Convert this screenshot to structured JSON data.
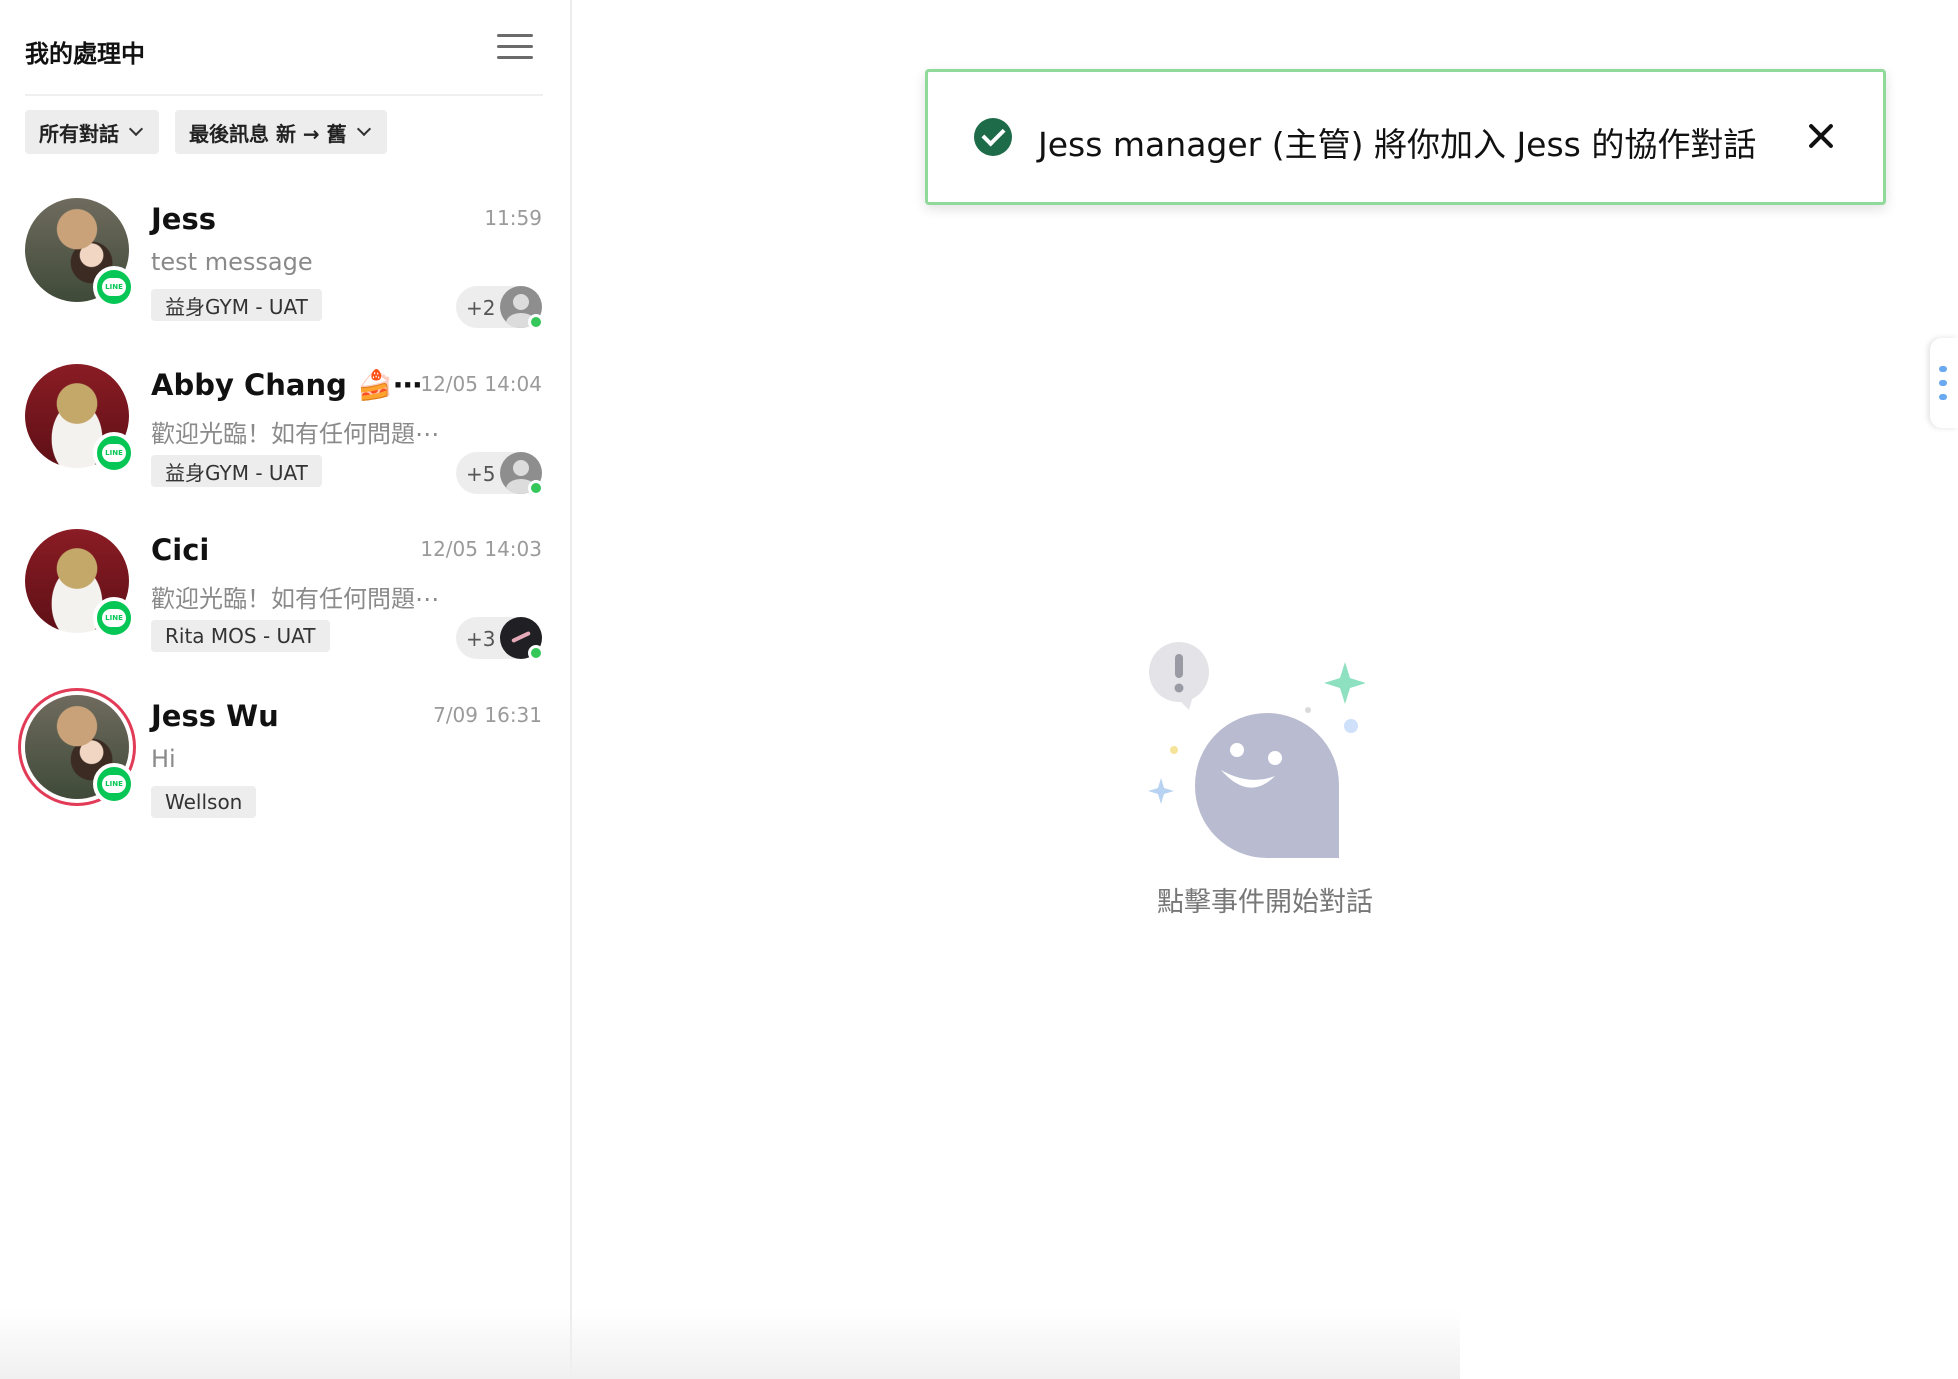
{
  "sidebar": {
    "title": "我的處理中",
    "filters": [
      {
        "label": "所有對話"
      },
      {
        "label": "最後訊息 新 → 舊"
      }
    ],
    "conversations": [
      {
        "name": "Jess",
        "time": "11:59",
        "message": "test message",
        "tag": "益身GYM - UAT",
        "collab_count": "+2",
        "channel": "LINE"
      },
      {
        "name": "Abby Chang 🍰⋯",
        "time": "12/05 14:04",
        "message": "歡迎光臨！如有任何問題⋯",
        "tag": "益身GYM - UAT",
        "collab_count": "+5",
        "channel": "LINE"
      },
      {
        "name": "Cici",
        "time": "12/05 14:03",
        "message": "歡迎光臨！如有任何問題⋯",
        "tag": "Rita MOS - UAT",
        "collab_count": "+3",
        "channel": "LINE"
      },
      {
        "name": "Jess Wu",
        "time": "7/09 16:31",
        "message": "Hi",
        "tag": "Wellson",
        "channel": "LINE"
      }
    ]
  },
  "toast": {
    "message": "Jess manager (主管) 將你加入 Jess 的協作對話",
    "border_color": "#8fd99a",
    "icon_color": "#1d6b48"
  },
  "empty_state": {
    "text": "點擊事件開始對話"
  },
  "colors": {
    "line_green": "#06c755",
    "online_green": "#35c759",
    "ring_red": "#e23b57"
  }
}
